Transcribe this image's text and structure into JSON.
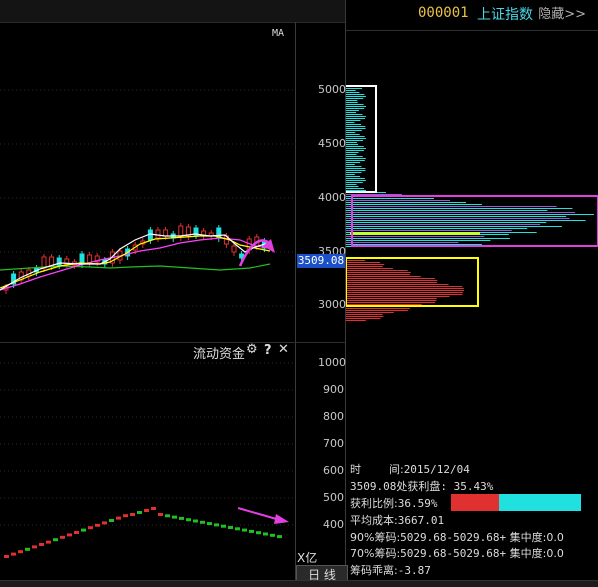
{
  "top_bar": {
    "hide_label": "隐藏>>"
  },
  "main_chart": {
    "ma_label": "MA",
    "y_axis_ticks": [
      "5000",
      "4500",
      "4000",
      "3500",
      "3000"
    ],
    "current_price": "3509.08"
  },
  "fund_panel": {
    "title": "流动资金",
    "y_axis_ticks": [
      "1000",
      "900",
      "800",
      "700",
      "600",
      "500",
      "400"
    ],
    "unit_label": "X亿",
    "period_tab": "日 线"
  },
  "right_panel": {
    "stock_code": "000001",
    "stock_name": "上证指数",
    "time_label": "时        间:",
    "time_value": "2015/12/04",
    "profit_at_price": "3509.08处获利盘: 35.43%",
    "profit_ratio_label": "获利比例:",
    "profit_ratio_value": "36.59%",
    "profit_ratio": 0.3659,
    "avg_cost_label": "平均成本:",
    "avg_cost_value": "3667.01",
    "chip90_label": "90%筹码:",
    "chip90_range": "5029.68-5029.68+",
    "chip90_concentration": "集中度:0.0",
    "chip70_label": "70%筹码:",
    "chip70_range": "5029.68-5029.68+",
    "chip70_concentration": "集中度:0.0",
    "deviation_label": "筹码乖离:",
    "deviation_value": "-3.87"
  },
  "colors": {
    "up": "#e03030",
    "down": "#20e0e0",
    "ma5": "#ffffff",
    "ma10": "#ffff00",
    "ma20": "#ff40ff",
    "ma60": "#20c020",
    "highlight_magenta": "#e040e0",
    "box_white": "#ffffff",
    "box_yellow": "#ffff00",
    "cost_line": "#c0ff30",
    "price_tag_bg": "#1b50c8"
  }
}
